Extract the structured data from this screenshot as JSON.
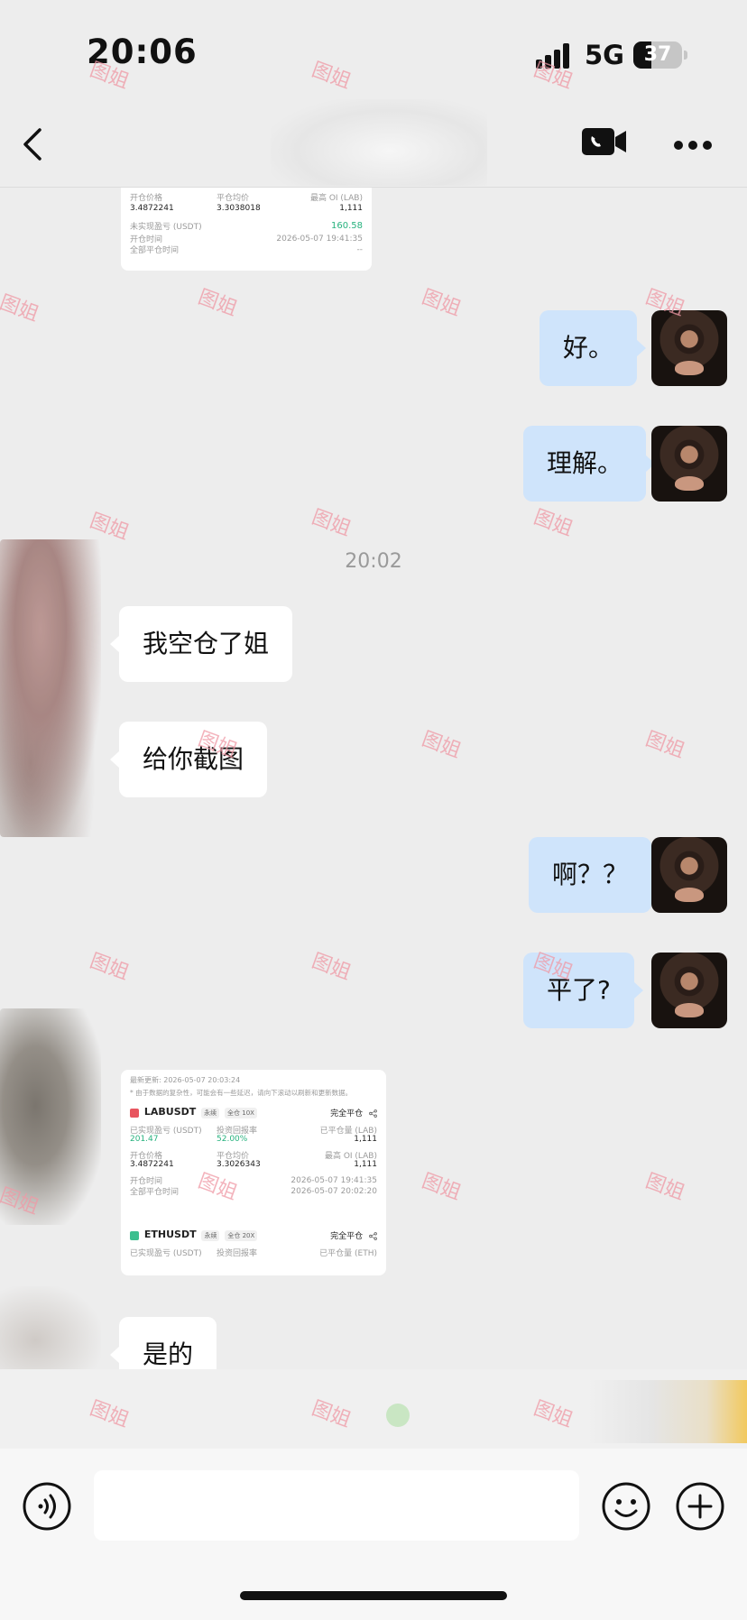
{
  "status_bar": {
    "time": "20:06",
    "network": "5G",
    "battery": "37"
  },
  "nav": {},
  "chat": {
    "timestamp": "20:02",
    "messages": [
      {
        "side": "right",
        "text": "好。"
      },
      {
        "side": "right",
        "text": "理解。"
      },
      {
        "side": "left",
        "text": "我空仓了姐"
      },
      {
        "side": "left",
        "text": "给你截图"
      },
      {
        "side": "right",
        "text": "啊？？"
      },
      {
        "side": "right",
        "text": "平了?"
      },
      {
        "side": "left",
        "text": "是的"
      }
    ],
    "card_top": {
      "row1": {
        "open_price_label": "开仓价格",
        "avg_close_label": "平仓均价",
        "max_oi_label": "最高 OI (LAB)"
      },
      "row1_values": {
        "open_price": "3.4872241",
        "avg_close": "3.3038018",
        "max_oi": "1,111"
      },
      "unrealized_label": "未实现盈亏 (USDT)",
      "unrealized_value": "160.58",
      "open_time_label": "开仓时间",
      "open_time": "2026-05-07 19:41:35",
      "close_time_label": "全部平仓时间",
      "close_time": "--"
    },
    "card_bottom": {
      "updated": "最新更新: 2026-05-07 20:03:24",
      "notice": "* 由于数据的复杂性，可能会有一些延迟，请向下滚动以刷新和更新数据。",
      "positions": [
        {
          "symbol": "LABUSDT",
          "tag1": "永续",
          "tag2": "全仓 10X",
          "status": "完全平仓",
          "icon_color": "#e8555f",
          "realized_label": "已实现盈亏 (USDT)",
          "realized": "201.47",
          "roi_label": "投资回报率",
          "roi": "52.00%",
          "closed_qty_label": "已平仓量 (LAB)",
          "closed_qty": "1,111",
          "open_price_label": "开仓价格",
          "open_price": "3.4872241",
          "avg_close_label": "平仓均价",
          "avg_close": "3.3026343",
          "max_oi_label": "最高 OI (LAB)",
          "max_oi": "1,111",
          "open_time_label": "开仓时间",
          "open_time": "2026-05-07 19:41:35",
          "close_time_label": "全部平仓时间",
          "close_time": "2026-05-07 20:02:20"
        },
        {
          "symbol": "ETHUSDT",
          "tag1": "永续",
          "tag2": "全仓 20X",
          "status": "完全平仓",
          "icon_color": "#3dbf8f",
          "realized_label": "已实现盈亏 (USDT)",
          "roi_label": "投资回报率",
          "closed_qty_label": "已平仓量 (ETH)"
        }
      ]
    }
  },
  "watermark": "图姐",
  "input": {
    "placeholder": ""
  },
  "icons": {
    "back": "chevron-left-icon",
    "video": "video-call-icon",
    "more": "more-dots-icon",
    "voice": "voice-icon",
    "emoji": "emoji-icon",
    "plus": "plus-icon",
    "share": "share-icon"
  },
  "colors": {
    "bubble_right": "#cfe4fb",
    "bubble_left": "#ffffff",
    "background": "#ededed",
    "profit_green": "#27b27e",
    "watermark": "#ef9aa6"
  }
}
